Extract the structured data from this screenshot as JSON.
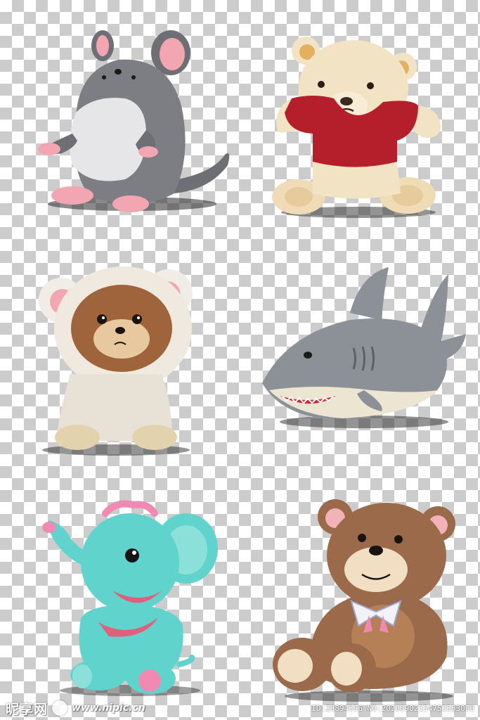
{
  "watermark": {
    "logo_text": "昵享网",
    "url": "www.nipic.cn",
    "id_line": "ID:28894596 NO:20200902154753583000"
  },
  "icons": [
    "mouse-plush",
    "teddy-bear-red-shirt",
    "bear-in-sheep-costume",
    "shark-plush",
    "elephant-plush",
    "brown-teddy-bear"
  ],
  "colors": {
    "checker_light": "#ffffff",
    "checker_dark": "#cccccc",
    "mouse_gray": "#7d7e83",
    "bear_cream": "#f1e3c4",
    "shirt_red": "#b51f2b",
    "shark_gray": "#8c9097",
    "elephant_teal": "#5fd3cc",
    "bear_brown": "#9a6a4b"
  }
}
